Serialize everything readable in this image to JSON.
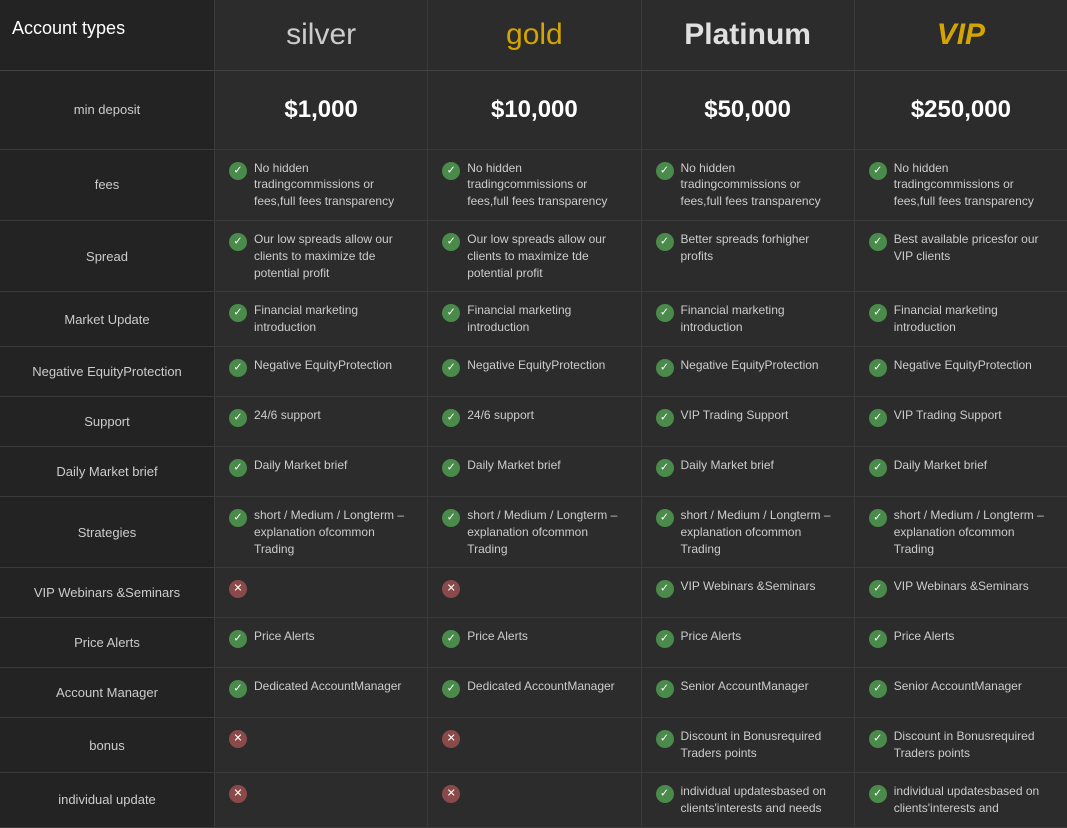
{
  "title": "Account types",
  "plans": [
    {
      "id": "silver",
      "name": "silver",
      "nameClass": "plan-name-silver",
      "deposit": "$1,000",
      "features": [
        {
          "icon": "check",
          "text": "No hidden tradingcommissions or fees,full fees transparency"
        },
        {
          "icon": "check",
          "text": "Our low spreads allow our clients to maximize tde potential profit"
        },
        {
          "icon": "check",
          "text": "Financial marketing introduction"
        },
        {
          "icon": "check",
          "text": "Negative EquityProtection"
        },
        {
          "icon": "check",
          "text": "24/6 support"
        },
        {
          "icon": "check",
          "text": "Daily Market brief"
        },
        {
          "icon": "check",
          "text": "short / Medium / Longterm – explanation ofcommon Trading"
        },
        {
          "icon": "cross",
          "text": ""
        },
        {
          "icon": "check",
          "text": "Price Alerts"
        },
        {
          "icon": "check",
          "text": "Dedicated AccountManager"
        },
        {
          "icon": "cross",
          "text": ""
        },
        {
          "icon": "cross",
          "text": ""
        }
      ]
    },
    {
      "id": "gold",
      "name": "gold",
      "nameClass": "plan-name-gold",
      "deposit": "$10,000",
      "features": [
        {
          "icon": "check",
          "text": "No hidden tradingcommissions or fees,full fees transparency"
        },
        {
          "icon": "check",
          "text": "Our low spreads allow our clients to maximize tde potential profit"
        },
        {
          "icon": "check",
          "text": "Financial marketing introduction"
        },
        {
          "icon": "check",
          "text": "Negative EquityProtection"
        },
        {
          "icon": "check",
          "text": "24/6 support"
        },
        {
          "icon": "check",
          "text": "Daily Market brief"
        },
        {
          "icon": "check",
          "text": "short / Medium / Longterm – explanation ofcommon Trading"
        },
        {
          "icon": "cross",
          "text": ""
        },
        {
          "icon": "check",
          "text": "Price Alerts"
        },
        {
          "icon": "check",
          "text": "Dedicated AccountManager"
        },
        {
          "icon": "cross",
          "text": ""
        },
        {
          "icon": "cross",
          "text": ""
        }
      ]
    },
    {
      "id": "platinum",
      "name": "Platinum",
      "nameClass": "plan-name-platinum",
      "deposit": "$50,000",
      "features": [
        {
          "icon": "check",
          "text": "No hidden tradingcommissions or fees,full fees transparency"
        },
        {
          "icon": "check",
          "text": "Better spreads forhigher profits"
        },
        {
          "icon": "check",
          "text": "Financial marketing introduction"
        },
        {
          "icon": "check",
          "text": "Negative EquityProtection"
        },
        {
          "icon": "check",
          "text": "VIP Trading Support"
        },
        {
          "icon": "check",
          "text": "Daily Market brief"
        },
        {
          "icon": "check",
          "text": "short / Medium / Longterm – explanation ofcommon Trading"
        },
        {
          "icon": "check",
          "text": "VIP Webinars &Seminars"
        },
        {
          "icon": "check",
          "text": "Price Alerts"
        },
        {
          "icon": "check",
          "text": "Senior AccountManager"
        },
        {
          "icon": "check",
          "text": "Discount in Bonusrequired Traders points"
        },
        {
          "icon": "check",
          "text": "individual updatesbased on clients'interests and needs"
        }
      ]
    },
    {
      "id": "vip",
      "name": "VIP",
      "nameClass": "plan-name-vip",
      "deposit": "$250,000",
      "features": [
        {
          "icon": "check",
          "text": "No hidden tradingcommissions or fees,full fees transparency"
        },
        {
          "icon": "check",
          "text": "Best available pricesfor our VIP clients"
        },
        {
          "icon": "check",
          "text": "Financial marketing introduction"
        },
        {
          "icon": "check",
          "text": "Negative EquityProtection"
        },
        {
          "icon": "check",
          "text": "VIP Trading Support"
        },
        {
          "icon": "check",
          "text": "Daily Market brief"
        },
        {
          "icon": "check",
          "text": "short / Medium / Longterm – explanation ofcommon Trading"
        },
        {
          "icon": "check",
          "text": "VIP Webinars &Seminars"
        },
        {
          "icon": "check",
          "text": "Price Alerts"
        },
        {
          "icon": "check",
          "text": "Senior AccountManager"
        },
        {
          "icon": "check",
          "text": "Discount in Bonusrequired Traders points"
        },
        {
          "icon": "check",
          "text": "individual updatesbased on clients'interests and"
        }
      ]
    }
  ],
  "rowLabels": [
    "min deposit",
    "fees",
    "Spread",
    "Market Update",
    "Negative EquityProtection",
    "Support",
    "Daily Market brief",
    "Strategies",
    "VIP Webinars &Seminars",
    "Price Alerts",
    "Account Manager",
    "bonus",
    "individual update"
  ]
}
